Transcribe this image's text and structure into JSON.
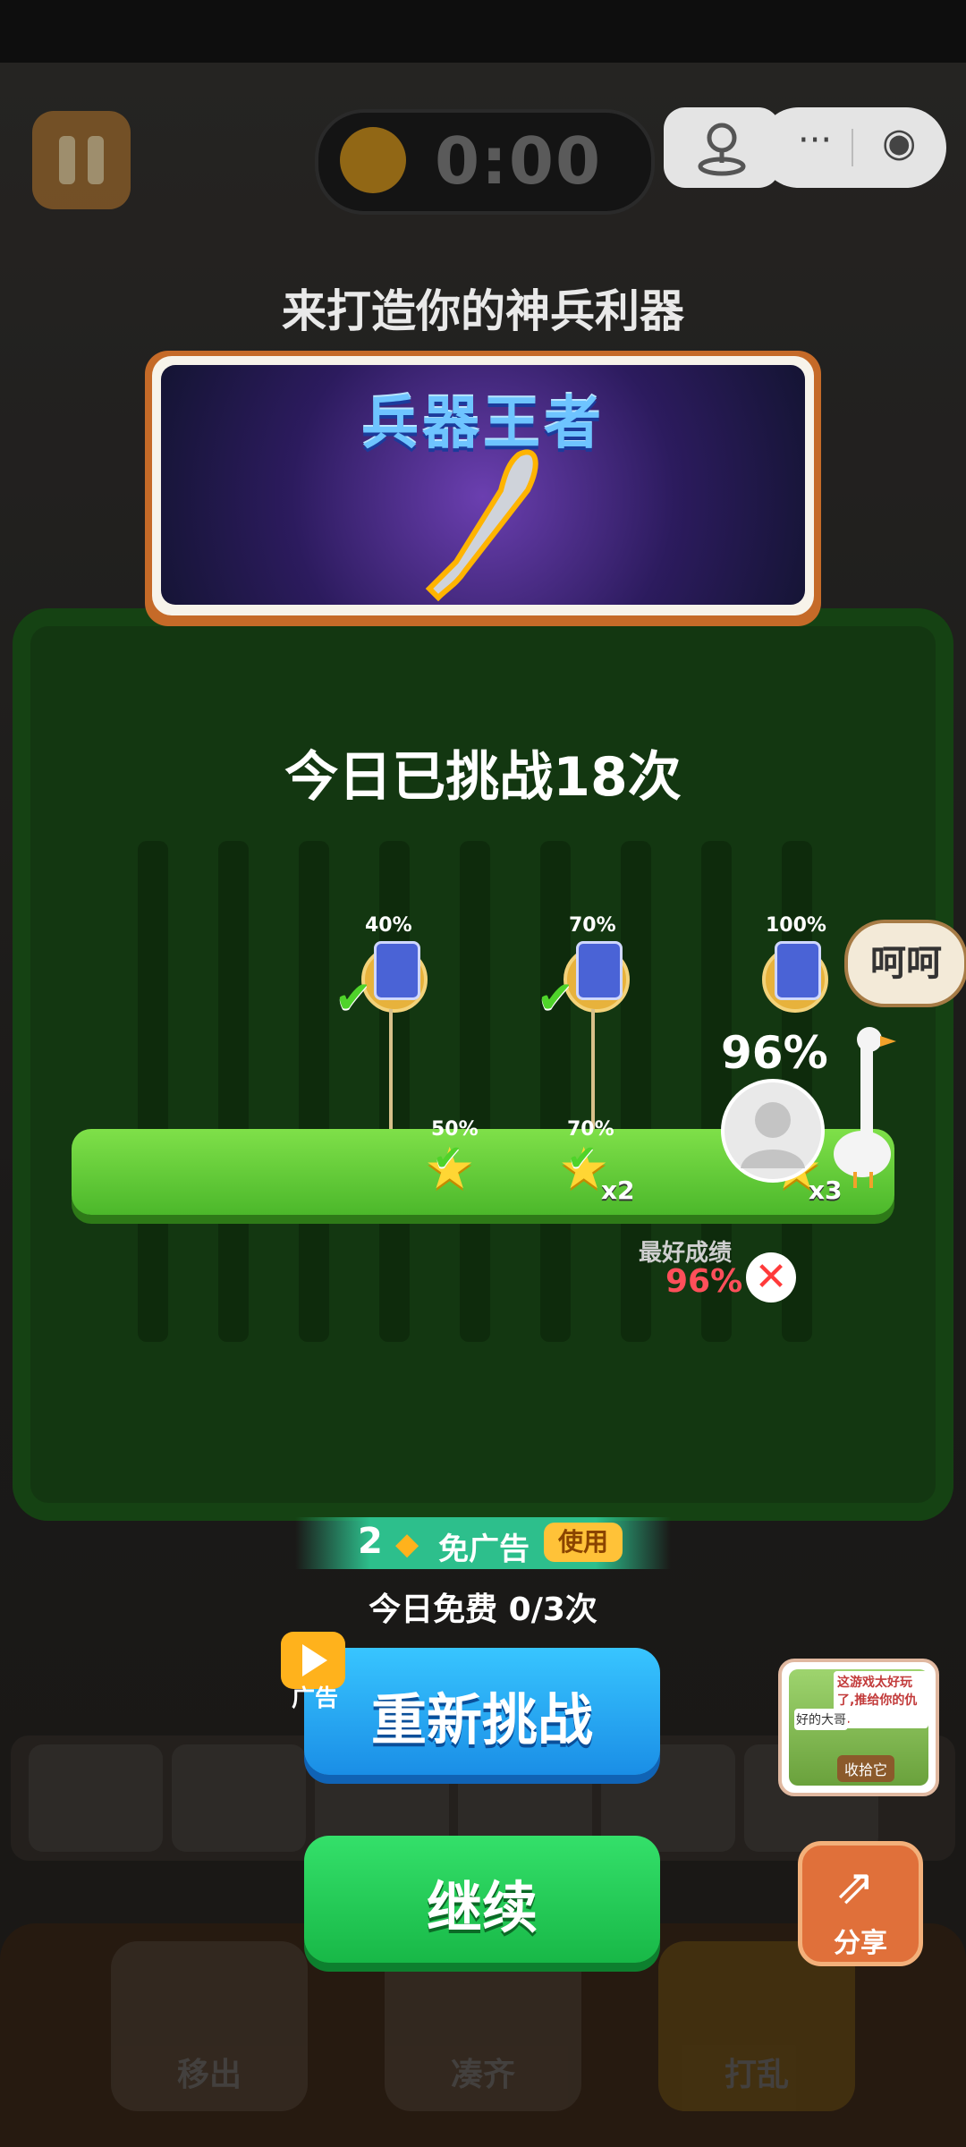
{
  "hud": {
    "timer": "0:00",
    "pause_icon": "pause-icon",
    "clock_icon": "alarm-clock-icon"
  },
  "mini_program": {
    "joystick_icon": "joystick-icon",
    "more_icon": "more-dots-icon",
    "close_icon": "record-circle-icon",
    "more_glyph": "···",
    "close_glyph": "◉"
  },
  "dialog": {
    "headline": "来打造你的神兵利器",
    "banner_title": "兵器王者",
    "challenge_count": "今日已挑战18次"
  },
  "progress": {
    "milestones_top": [
      {
        "pct": "40%",
        "done": true
      },
      {
        "pct": "70%",
        "done": true
      },
      {
        "pct": "100%",
        "done": false
      }
    ],
    "milestones_bottom": [
      {
        "pct": "50%",
        "done": true,
        "mult": ""
      },
      {
        "pct": "70%",
        "done": true,
        "mult": "x2"
      },
      {
        "pct": "",
        "done": false,
        "mult": "x3"
      }
    ],
    "current_pct": "96%",
    "current_value": 0.96,
    "bubble": "呵呵",
    "best_label": "最好成绩",
    "best_value": "96%",
    "best_fail_glyph": "✕"
  },
  "ad_free": {
    "count": "2",
    "text": "免广告",
    "use_label": "使用",
    "free_today": "今日免费 0/3次"
  },
  "buttons": {
    "retry": "重新挑战",
    "ad_label": "广告",
    "continue": "继续",
    "share": "分享"
  },
  "share_card": {
    "caption": "这游戏太好玩了,推给你的仇人",
    "sub": "好的大哥",
    "pick": "收拾它"
  },
  "tools": [
    "移出",
    "凑齐",
    "打乱"
  ],
  "colors": {
    "retry": "#1a8ee6",
    "continue": "#18b847",
    "best": "#ff4f5a",
    "accent_gold": "#ffb21c"
  }
}
